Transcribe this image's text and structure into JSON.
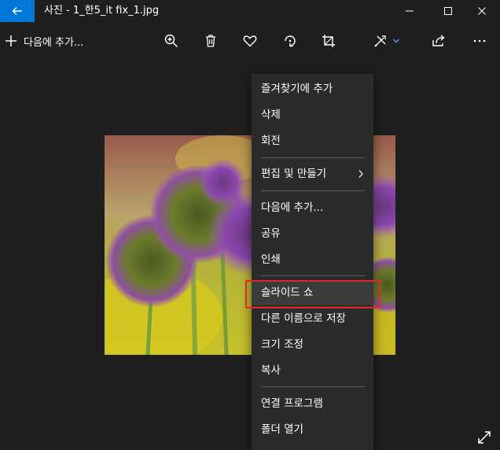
{
  "window": {
    "title": "사진 - 1_한5_it fix_1.jpg"
  },
  "toolbar": {
    "add_to_label": "다음에 추가...",
    "icons": [
      "zoom-in-icon",
      "delete-icon",
      "favorite-icon",
      "rotate-icon",
      "crop-icon",
      "edit-create-icon",
      "share-icon",
      "more-icon"
    ]
  },
  "menu": {
    "items": [
      {
        "label": "즐겨찾기에 추가"
      },
      {
        "label": "삭제"
      },
      {
        "label": "회전"
      },
      {
        "label": "편집 및 만들기"
      },
      {
        "label": "다음에 추가..."
      },
      {
        "label": "공유"
      },
      {
        "label": "인쇄"
      },
      {
        "label": "슬라이드 쇼"
      },
      {
        "label": "다른 이름으로 저장"
      },
      {
        "label": "크기 조정"
      },
      {
        "label": "복사"
      },
      {
        "label": "연결 프로그램"
      },
      {
        "label": "폴더 열기"
      }
    ],
    "highlighted_index": 7
  },
  "colors": {
    "accent": "#0078d7",
    "background": "#1f1f1f",
    "menu_background": "#2b2b2b",
    "highlight_box": "#e8252b"
  }
}
